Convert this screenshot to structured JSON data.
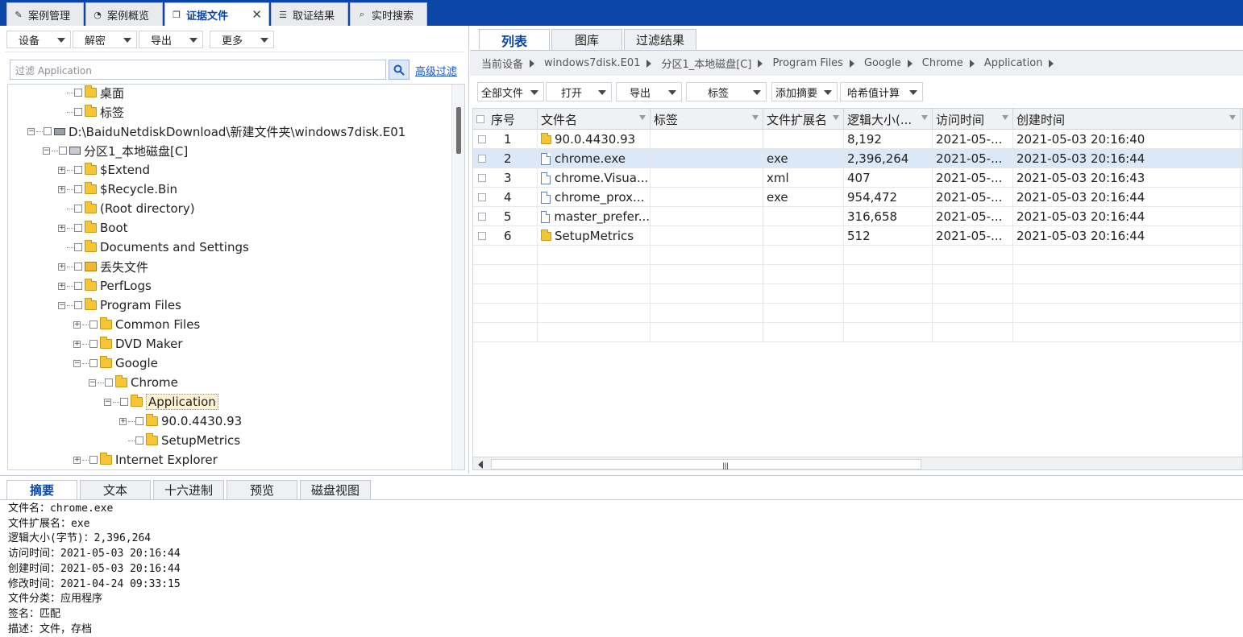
{
  "top_tabs": [
    {
      "label": "案例管理",
      "icon": "edit-icon"
    },
    {
      "label": "案例概览",
      "icon": "gauge-icon"
    },
    {
      "label": "证据文件",
      "icon": "file-copy-icon",
      "active": true
    },
    {
      "label": "取证结果",
      "icon": "result-list-icon"
    },
    {
      "label": "实时搜索",
      "icon": "search-icon"
    }
  ],
  "left_toolbar": [
    "设备",
    "解密",
    "导出",
    "更多"
  ],
  "filter": {
    "placeholder": "过滤 Application",
    "advanced_label": "高级过滤"
  },
  "tree": [
    {
      "label": "桌面",
      "indent": 2,
      "icon": "folder",
      "expander": "none"
    },
    {
      "label": "标签",
      "indent": 2,
      "icon": "folder",
      "expander": "none"
    },
    {
      "label": "D:\\BaiduNetdiskDownload\\新建文件夹\\windows7disk.E01",
      "indent": 0,
      "icon": "drive",
      "expander": "-"
    },
    {
      "label": "分区1_本地磁盘[C]",
      "indent": 1,
      "icon": "disk",
      "expander": "-"
    },
    {
      "label": "$Extend",
      "indent": 2,
      "icon": "folder",
      "expander": "+"
    },
    {
      "label": "$Recycle.Bin",
      "indent": 2,
      "icon": "folder",
      "expander": "+"
    },
    {
      "label": "(Root directory)",
      "indent": 2,
      "icon": "folder",
      "expander": "none"
    },
    {
      "label": "Boot",
      "indent": 2,
      "icon": "folder",
      "expander": "+"
    },
    {
      "label": "Documents and Settings",
      "indent": 2,
      "icon": "folder",
      "expander": "none"
    },
    {
      "label": "丢失文件",
      "indent": 2,
      "icon": "lost",
      "expander": "+"
    },
    {
      "label": "PerfLogs",
      "indent": 2,
      "icon": "folder",
      "expander": "+"
    },
    {
      "label": "Program Files",
      "indent": 2,
      "icon": "folder",
      "expander": "-"
    },
    {
      "label": "Common Files",
      "indent": 3,
      "icon": "folder",
      "expander": "+"
    },
    {
      "label": "DVD Maker",
      "indent": 3,
      "icon": "folder",
      "expander": "+"
    },
    {
      "label": "Google",
      "indent": 3,
      "icon": "folder",
      "expander": "-"
    },
    {
      "label": "Chrome",
      "indent": 4,
      "icon": "folder",
      "expander": "-"
    },
    {
      "label": "Application",
      "indent": 5,
      "icon": "folder",
      "expander": "-",
      "selected": true
    },
    {
      "label": "90.0.4430.93",
      "indent": 6,
      "icon": "folder",
      "expander": "+"
    },
    {
      "label": "SetupMetrics",
      "indent": 6,
      "icon": "folder",
      "expander": "none"
    },
    {
      "label": "Internet Explorer",
      "indent": 3,
      "icon": "folder",
      "expander": "+"
    }
  ],
  "right_tabs": [
    "列表",
    "图库",
    "过滤结果"
  ],
  "breadcrumb": [
    "当前设备",
    "windows7disk.E01",
    "分区1_本地磁盘[C]",
    "Program Files",
    "Google",
    "Chrome",
    "Application"
  ],
  "right_toolbar": [
    "全部文件",
    "打开",
    "导出",
    "标签",
    "添加摘要",
    "哈希值计算"
  ],
  "table": {
    "headers": [
      "序号",
      "文件名",
      "标签",
      "文件扩展名",
      "逻辑大小(...",
      "访问时间",
      "创建时间"
    ],
    "rows": [
      {
        "no": "1",
        "name": "90.0.4430.93",
        "type": "folder",
        "tag": "",
        "ext": "",
        "size": "8,192",
        "access": "2021-05-...",
        "created": "2021-05-03 20:16:40"
      },
      {
        "no": "2",
        "name": "chrome.exe",
        "type": "file",
        "tag": "",
        "ext": "exe",
        "size": "2,396,264",
        "access": "2021-05-...",
        "created": "2021-05-03 20:16:44",
        "selected": true
      },
      {
        "no": "3",
        "name": "chrome.Visua...",
        "type": "file",
        "tag": "",
        "ext": "xml",
        "size": "407",
        "access": "2021-05-...",
        "created": "2021-05-03 20:16:43"
      },
      {
        "no": "4",
        "name": "chrome_prox...",
        "type": "file",
        "tag": "",
        "ext": "exe",
        "size": "954,472",
        "access": "2021-05-...",
        "created": "2021-05-03 20:16:44"
      },
      {
        "no": "5",
        "name": "master_prefer...",
        "type": "file",
        "tag": "",
        "ext": "",
        "size": "316,658",
        "access": "2021-05-...",
        "created": "2021-05-03 20:16:44"
      },
      {
        "no": "6",
        "name": "SetupMetrics",
        "type": "folder",
        "tag": "",
        "ext": "",
        "size": "512",
        "access": "2021-05-...",
        "created": "2021-05-03 20:16:44"
      }
    ]
  },
  "bottom_tabs": [
    "摘要",
    "文本",
    "十六进制",
    "预览",
    "磁盘视图"
  ],
  "summary_lines": [
    "文件名：chrome.exe",
    "文件扩展名：exe",
    "逻辑大小(字节)：2,396,264",
    "访问时间：2021-05-03 20:16:44",
    "创建时间：2021-05-03 20:16:44",
    "修改时间：2021-04-24 09:33:15",
    "文件分类：应用程序",
    "签名：匹配",
    "描述：文件，存档"
  ],
  "colors": {
    "titlebar": "#0b46a6",
    "accent": "#0b46a6",
    "selection": "#dbe8f8"
  }
}
